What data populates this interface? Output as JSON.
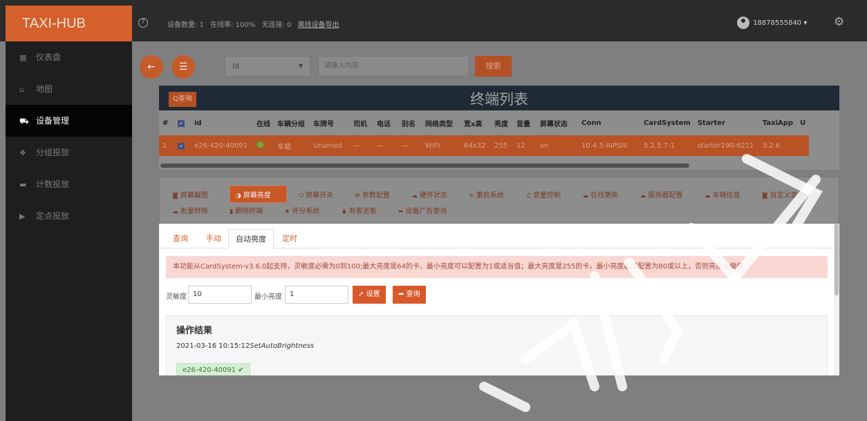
{
  "app": {
    "brand": "TAXI-HUB"
  },
  "header": {
    "stats": {
      "device_count": "设备数量: 1",
      "online_rate": "在线率: 100%",
      "no_connection": "无连接: 0",
      "export_link": "离线设备导出"
    },
    "user": "18878555840"
  },
  "sidebar": {
    "items": [
      {
        "label": "仪表盘",
        "icon": "dashboard-icon",
        "glyph": "▦"
      },
      {
        "label": "地图",
        "icon": "map-icon",
        "glyph": "⌂"
      },
      {
        "label": "设备管理",
        "icon": "car-icon",
        "glyph": "⛟"
      },
      {
        "label": "分组投放",
        "icon": "group-icon",
        "glyph": "❖"
      },
      {
        "label": "计数投放",
        "icon": "counter-icon",
        "glyph": "▬"
      },
      {
        "label": "定点投放",
        "icon": "play-icon",
        "glyph": "▶"
      }
    ]
  },
  "search": {
    "field_value": "id",
    "placeholder": "请输入内容",
    "button": "搜索"
  },
  "terminal_list": {
    "query_button": "Q查询",
    "title": "终端列表",
    "headers": [
      "#",
      "id",
      "在线",
      "车辆分组",
      "车牌号",
      "司机",
      "电话",
      "别名",
      "网络类型",
      "宽x高",
      "亮度",
      "音量",
      "屏幕状态",
      "Conn",
      "CardSystem",
      "Starter",
      "TaxiApp",
      "U"
    ],
    "rows": [
      [
        "1",
        "e26-420-40091",
        "",
        "车载",
        "Unamed",
        "—",
        "—",
        "—",
        "WIFI",
        "64x32",
        "255",
        "12",
        "on",
        "10.4.5-AIPSIII",
        "5.2.5.7-1",
        "starter190-6211",
        "3.2.6",
        ""
      ]
    ]
  },
  "ops": {
    "row1": [
      "屏幕截图",
      "屏幕亮度",
      "屏幕开关",
      "参数配置",
      "硬件状态",
      "重启系统",
      "音量控制",
      "在线更新",
      "服务器配置",
      "车辆信息",
      "自定义显示"
    ],
    "row2": [
      "批量转移",
      "删除终端",
      "评分系统",
      "有客无客",
      "设备广告查询"
    ]
  },
  "brightness": {
    "tabs": [
      "查询",
      "手动",
      "自动亮度",
      "定时"
    ],
    "notice": "本功能从CardSystem-v3.6.0起支持，灵敏度必需为0到100;最大亮度是64的卡，最小亮度可以配置为1或适当值；最大亮度是255的卡，最小亮度必须配置为80或以上，否则亮度会偏低。",
    "sensitivity_label": "灵敏度",
    "sensitivity_value": "10",
    "min_brightness_label": "最小亮度",
    "min_brightness_value": "1",
    "set_button": "设置",
    "query_button": "查询"
  },
  "result": {
    "title": "操作结果",
    "timestamp": "2021-03-16 10:15:12",
    "command": "SetAutoBrightness",
    "device": "e26-420-40091 ✔"
  }
}
